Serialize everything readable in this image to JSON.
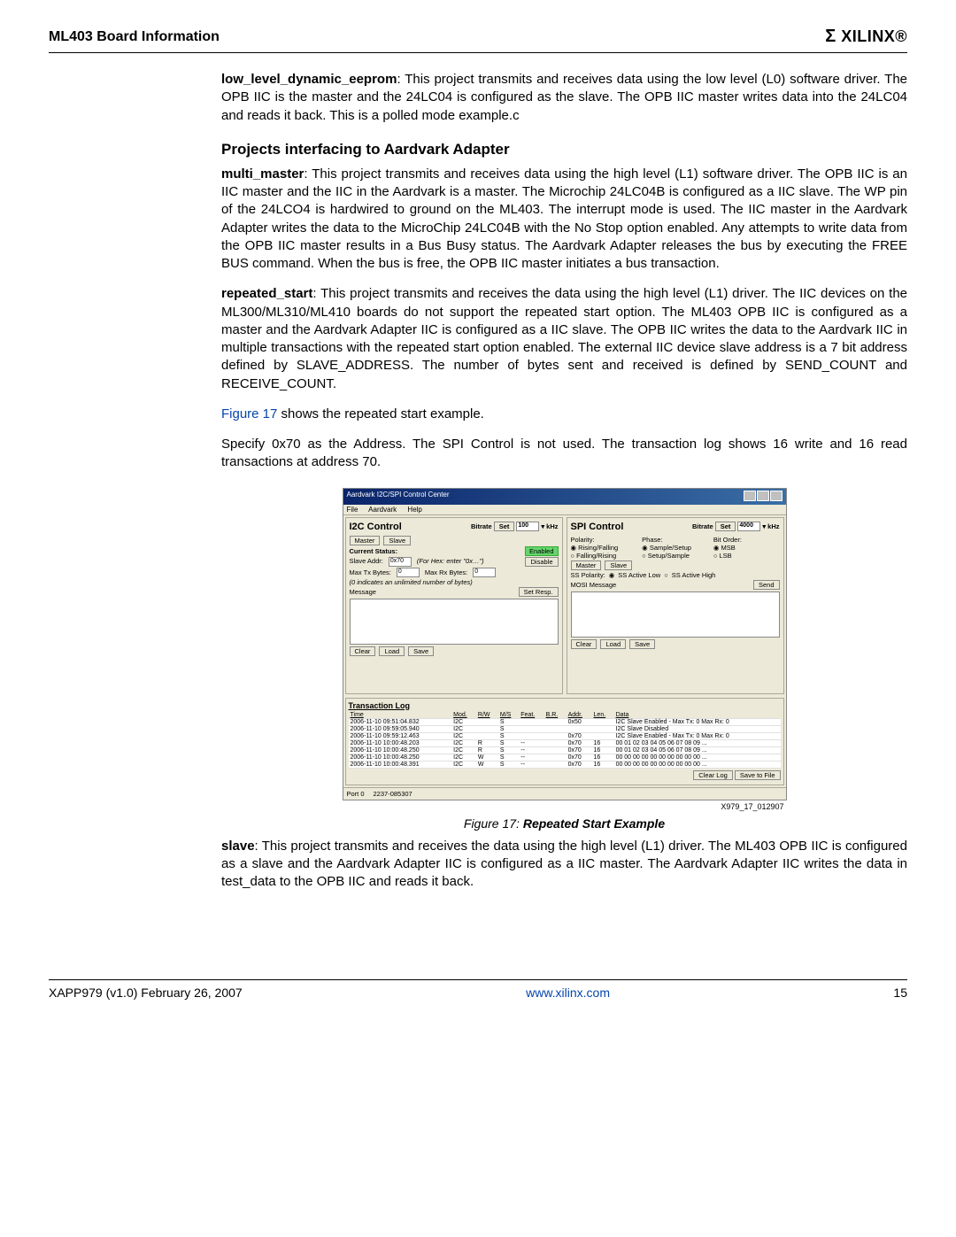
{
  "header": {
    "title": "ML403 Board Information",
    "logo": "XILINX"
  },
  "paragraphs": {
    "p1_lead": "low_level_dynamic_eeprom",
    "p1_rest": ": This project transmits and receives data using the low level (L0) software driver. The OPB IIC is the master and the 24LC04 is configured as the slave. The OPB IIC master writes data into the 24LC04 and reads it back. This is a polled mode example.c",
    "section_h": "Projects interfacing to Aardvark Adapter",
    "p2_lead": "multi_master",
    "p2_rest": ": This project transmits and receives data using the high level (L1) software driver. The OPB IIC is an IIC master and the IIC in the Aardvark is a master. The Microchip 24LC04B is configured as a IIC slave. The WP pin of the 24LCO4 is hardwired to ground on the ML403. The interrupt mode is used. The IIC master in the Aardvark Adapter writes the data to the MicroChip 24LC04B with the No Stop option enabled. Any attempts to write data from the OPB IIC master results in a Bus Busy status. The Aardvark Adapter releases the bus by executing the FREE BUS command. When the bus is free, the OPB IIC master initiates a bus transaction.",
    "p3_lead": "repeated_start",
    "p3_rest": ": This project transmits and receives the data using the high level (L1) driver. The IIC devices on the ML300/ML310/ML410 boards do not support the repeated start option. The ML403 OPB IIC is configured as a master and the Aardvark Adapter IIC is configured as a IIC slave. The OPB IIC writes the data to the Aardvark IIC in multiple transactions with the repeated start option enabled. The external IIC device slave address is a 7 bit address defined by SLAVE_ADDRESS. The number of bytes sent and received is defined by SEND_COUNT and RECEIVE_COUNT.",
    "p4_link": "Figure 17",
    "p4_rest": " shows the repeated start example.",
    "p5": "Specify 0x70 as the Address. The SPI Control is not used. The transaction log shows 16 write and 16 read transactions at address 70.",
    "p6_lead": "slave",
    "p6_rest": ": This project transmits and receives the data using the high level (L1) driver. The ML403 OPB IIC is configured as a slave and the Aardvark Adapter IIC is configured as a IIC master. The Aardvark Adapter IIC writes the data in test_data to the OPB IIC and reads it back."
  },
  "figure": {
    "window_title": "Aardvark I2C/SPI Control Center",
    "menu": {
      "file": "File",
      "aardvark": "Aardvark",
      "help": "Help"
    },
    "i2c": {
      "title": "I2C Control",
      "bitrate_lbl": "Bitrate",
      "set_btn": "Set",
      "bitrate_val": "100",
      "khz": "kHz",
      "tabs": {
        "master": "Master",
        "slave": "Slave"
      },
      "current_status_lbl": "Current Status:",
      "enabled": "Enabled",
      "slave_addr_lbl": "Slave Addr:",
      "slave_addr_val": "0x70",
      "hex_hint": "(For Hex: enter \"0x…\")",
      "disable_btn": "Disable",
      "max_tx_lbl": "Max Tx Bytes:",
      "max_tx_val": "0",
      "max_rx_lbl": "Max Rx Bytes:",
      "max_rx_val": "0",
      "zero_hint": "(0 indicates an unlimited number of bytes)",
      "message_lbl": "Message",
      "set_resp_btn": "Set Resp.",
      "clear_btn": "Clear",
      "load_btn": "Load",
      "save_btn": "Save"
    },
    "spi": {
      "title": "SPI Control",
      "bitrate_lbl": "Bitrate",
      "set_btn": "Set",
      "bitrate_val": "4000",
      "khz": "kHz",
      "polarity_lbl": "Polarity:",
      "pol1": "Rising/Falling",
      "pol2": "Falling/Rising",
      "phase_lbl": "Phase:",
      "ph1": "Sample/Setup",
      "ph2": "Setup/Sample",
      "bitorder_lbl": "Bit Order:",
      "bo1": "MSB",
      "bo2": "LSB",
      "tabs": {
        "master": "Master",
        "slave": "Slave"
      },
      "ss_pol_lbl": "SS Polarity:",
      "ss1": "SS Active Low",
      "ss2": "SS Active High",
      "mosi_lbl": "MOSI Message",
      "send_btn": "Send",
      "clear_btn": "Clear",
      "load_btn": "Load",
      "save_btn": "Save"
    },
    "txlog": {
      "title": "Transaction Log",
      "headers": [
        "Time",
        "Mod.",
        "R/W",
        "M/S",
        "Feat.",
        "B.R.",
        "Addr.",
        "Len.",
        "Data"
      ],
      "rows": [
        [
          "2006-11-10 09:51:04.832",
          "I2C",
          "",
          "S",
          "",
          "",
          "0x50",
          "",
          "I2C Slave Enabled - Max Tx: 0 Max Rx: 0"
        ],
        [
          "2006-11-10 09:59:05.940",
          "I2C",
          "",
          "S",
          "",
          "",
          "",
          "",
          "I2C Slave Disabled"
        ],
        [
          "2006-11-10 09:59:12.463",
          "I2C",
          "",
          "S",
          "",
          "",
          "0x70",
          "",
          "I2C Slave Enabled - Max Tx: 0 Max Rx: 0"
        ],
        [
          "2006-11-10 10:00:48.203",
          "I2C",
          "R",
          "S",
          "--",
          "",
          "0x70",
          "16",
          "00 01 02 03 04 05 06 07 08 09 ..."
        ],
        [
          "2006-11-10 10:00:48.250",
          "I2C",
          "R",
          "S",
          "--",
          "",
          "0x70",
          "16",
          "00 01 02 03 04 05 06 07 08 09 ..."
        ],
        [
          "2006-11-10 10:00:48.250",
          "I2C",
          "W",
          "S",
          "--",
          "",
          "0x70",
          "16",
          "00 00 00 00 00 00 00 00 00 00 ..."
        ],
        [
          "2006-11-10 10:00:48.391",
          "I2C",
          "W",
          "S",
          "--",
          "",
          "0x70",
          "16",
          "00 00 00 00 00 00 00 00 00 00 ..."
        ]
      ],
      "clear_log": "Clear Log",
      "save_file": "Save to File"
    },
    "status": {
      "port": "Port 0",
      "serial": "2237-085307"
    },
    "fig_id": "X979_17_012907",
    "caption_prefix": "Figure 17:",
    "caption_rest": "  Repeated Start Example"
  },
  "footer": {
    "left": "XAPP979 (v1.0) February 26, 2007",
    "center": "www.xilinx.com",
    "right": "15"
  }
}
